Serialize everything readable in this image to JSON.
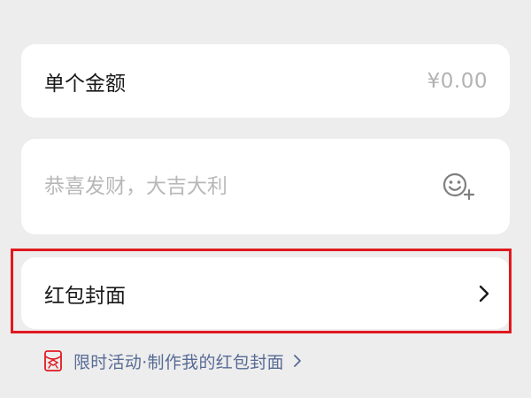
{
  "amount": {
    "label": "单个金额",
    "value": "¥0.00"
  },
  "greeting": {
    "placeholder": "恭喜发财，大吉大利",
    "emoji_icon": "emoji-add-icon"
  },
  "cover": {
    "label": "红包封面",
    "chevron_icon": "chevron-right-icon"
  },
  "promo": {
    "text": "限时活动·制作我的红包封面",
    "icon": "red-envelope-icon",
    "chevron_icon": "chevron-right-icon"
  },
  "colors": {
    "background": "#ededed",
    "card": "#ffffff",
    "highlight": "#e0191f",
    "link": "#576b95",
    "placeholder": "#b8b8b8"
  }
}
